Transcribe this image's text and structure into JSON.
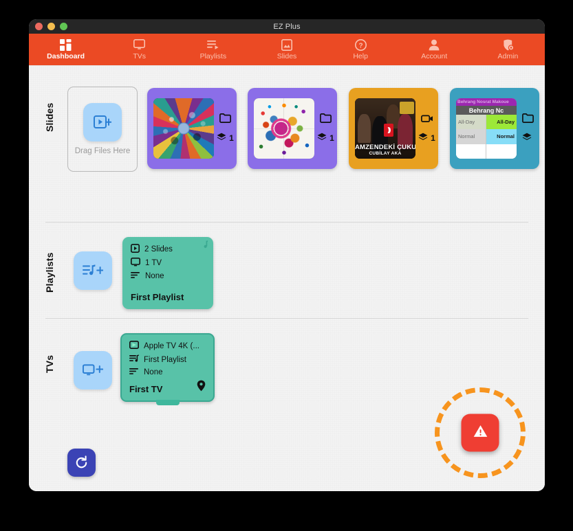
{
  "window": {
    "title": "EZ Plus",
    "traffic_lights": [
      "close-red",
      "minimize-yellow",
      "maximize-green"
    ]
  },
  "nav": {
    "items": [
      {
        "label": "Dashboard",
        "icon": "dashboard-grid-icon",
        "active": true
      },
      {
        "label": "TVs",
        "icon": "tv-monitor-icon",
        "active": false
      },
      {
        "label": "Playlists",
        "icon": "playlist-play-icon",
        "active": false
      },
      {
        "label": "Slides",
        "icon": "image-slide-icon",
        "active": false
      },
      {
        "label": "Help",
        "icon": "question-circle-icon",
        "active": false
      },
      {
        "label": "Account",
        "icon": "person-icon",
        "active": false
      },
      {
        "label": "Admin",
        "icon": "admin-shield-icon",
        "active": false
      }
    ],
    "background_color": "#eb4a24",
    "active_color": "#ffffff",
    "inactive_color": "#fbc0ae"
  },
  "sections": {
    "slides": {
      "label": "Slides",
      "dropzone_text": "Drag Files Here",
      "add_icon": "add-slide-icon",
      "cards": [
        {
          "frame_color": "#8b6ee8",
          "type_icon": "folder-icon",
          "layers_icon": "layers-icon",
          "layers_count": "1",
          "art": "burst",
          "caption": "",
          "subcaption": ""
        },
        {
          "frame_color": "#8b6ee8",
          "type_icon": "folder-icon",
          "layers_icon": "layers-icon",
          "layers_count": "1",
          "art": "white-circles",
          "caption": "",
          "subcaption": ""
        },
        {
          "frame_color": "#e8a020",
          "type_icon": "video-camera-icon",
          "layers_icon": "layers-icon",
          "layers_count": "1",
          "art": "video",
          "caption": "AMZENDEKİ ÇUKUR",
          "subcaption": "CUBİLAY AKA"
        },
        {
          "frame_color": "#3ba0bf",
          "type_icon": "folder-icon",
          "layers_icon": "layers-icon",
          "layers_count": "",
          "art": "calendar",
          "cal_bar_text": "Behrang Nosrat Makouе",
          "cal_header_text": "Behrang Nc",
          "cal_cells": [
            "All-Day",
            "All-Day",
            "Normal",
            "Normal",
            "",
            ""
          ]
        }
      ]
    },
    "playlists": {
      "label": "Playlists",
      "add_icon": "add-playlist-icon",
      "cards": [
        {
          "rows": [
            {
              "icon": "slide-icon",
              "text": "2 Slides"
            },
            {
              "icon": "tv-monitor-icon",
              "text": "1 TV"
            },
            {
              "icon": "list-icon",
              "text": "None"
            }
          ],
          "title": "First Playlist",
          "corner_icon": "music-note-icon",
          "color": "#58c2a8"
        }
      ]
    },
    "tvs": {
      "label": "TVs",
      "add_icon": "add-tv-icon",
      "cards": [
        {
          "rows": [
            {
              "icon": "airplay-icon",
              "text": "Apple TV 4K (..."
            },
            {
              "icon": "playlist-play-icon",
              "text": "First Playlist"
            },
            {
              "icon": "list-icon",
              "text": "None"
            }
          ],
          "title": "First TV",
          "corner_icon": "location-pin-icon",
          "color": "#58c2a8"
        }
      ]
    }
  },
  "footer": {
    "refresh_button": {
      "icon": "refresh-icon",
      "color": "#3b43b5"
    },
    "alert_button": {
      "icon": "warning-triangle-icon",
      "color": "#ef3e33",
      "highlight_ring_color": "#f7941e"
    }
  }
}
